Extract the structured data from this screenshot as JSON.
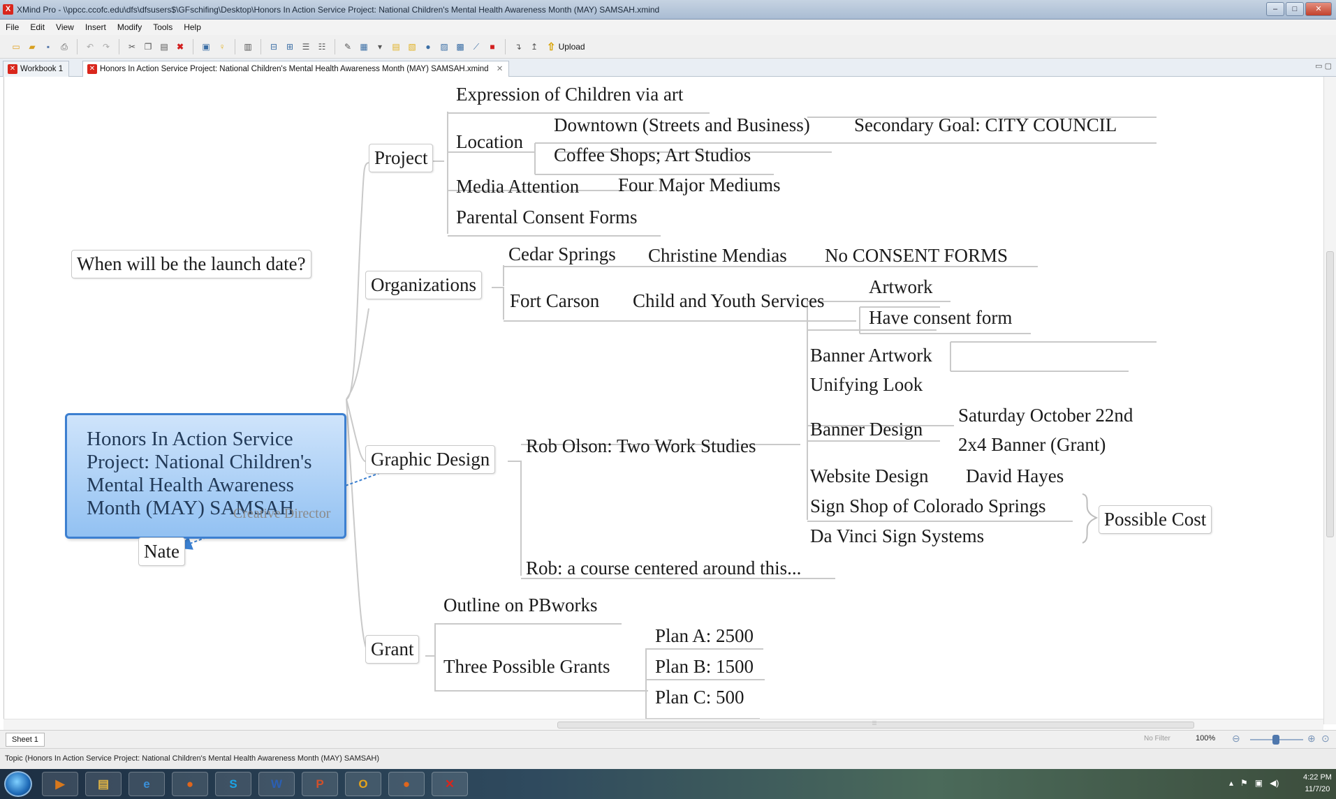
{
  "window": {
    "title": "XMind Pro - \\\\ppcc.ccofc.edu\\dfs\\dfsusers$\\GFschifing\\Desktop\\Honors In Action Service Project: National Children's Mental Health Awareness Month (MAY) SAMSAH.xmind",
    "app_icon": "X"
  },
  "menu": [
    "File",
    "Edit",
    "View",
    "Insert",
    "Modify",
    "Tools",
    "Help"
  ],
  "toolbar": {
    "icons": [
      "new-icon",
      "open-icon",
      "save-icon",
      "print-icon",
      "undo-icon",
      "redo-icon",
      "cut-icon",
      "copy-icon",
      "paste-icon",
      "delete-icon",
      "topic-icon",
      "idea-icon",
      "outline-icon",
      "insert-subtopic-icon",
      "insert-topic-icon",
      "boundary-icon",
      "summary-icon",
      "relationship-icon",
      "marker-icon",
      "notes-icon",
      "attachment-icon",
      "label-icon",
      "image-icon",
      "hyperlink-icon",
      "drilldown-icon",
      "drillup-icon"
    ],
    "upload_label": "Upload"
  },
  "tabs": [
    {
      "label": "Workbook 1"
    },
    {
      "label": "Honors In Action Service Project: National Children's Mental Health Awareness Month (MAY) SAMSAH.xmind"
    }
  ],
  "map": {
    "central": {
      "lines": [
        "Honors In Action Service",
        "Project: National Children's",
        "Mental Health Awareness",
        "Month (MAY) SAMSAH"
      ]
    },
    "floating": "When will be the launch date?",
    "nate": "Nate",
    "relationship_label": "Creative Director",
    "project": {
      "label": "Project",
      "expression": "Expression of Children via art",
      "location": "Location",
      "downtown": "Downtown (Streets and Business)",
      "secondary_goal": "Secondary Goal: CITY COUNCIL",
      "coffee": "Coffee Shops; Art Studios",
      "media": "Media Attention",
      "four_major": "Four Major Mediums",
      "parental": "Parental Consent Forms"
    },
    "organizations": {
      "label": "Organizations",
      "cedar": "Cedar Springs",
      "christine": "Christine Mendias",
      "no_consent": "No CONSENT FORMS",
      "fort_carson": "Fort Carson",
      "child_youth": "Child and Youth Services",
      "artwork": "Artwork",
      "have_consent": "Have consent form"
    },
    "graphic_design": {
      "label": "Graphic Design",
      "rob_olson": "Rob Olson: Two Work Studies",
      "banner_artwork": "Banner Artwork",
      "unifying": "Unifying Look",
      "banner_design": "Banner Design",
      "saturday": "Saturday October 22nd",
      "banner_2x4": "2x4 Banner (Grant)",
      "website": "Website Design",
      "david": "David Hayes",
      "sign_shop": "Sign Shop of Colorado Springs",
      "da_vinci": "Da Vinci Sign Systems",
      "possible_cost": "Possible Cost",
      "rob_course": "Rob: a course centered around this..."
    },
    "grant": {
      "label": "Grant",
      "outline": "Outline on PBworks",
      "three": "Three Possible Grants",
      "plan_a": "Plan A: 2500",
      "plan_b": "Plan B: 1500",
      "plan_c": "Plan C: 500"
    }
  },
  "sheet_tab": "Sheet 1",
  "filter": "No Filter",
  "zoom": "100%",
  "status": "Topic (Honors In Action Service Project: National Children's Mental Health Awareness Month (MAY) SAMSAH)",
  "taskbar": {
    "apps": [
      {
        "name": "media-player-icon",
        "glyph": "▶",
        "color": "#d8781c"
      },
      {
        "name": "explorer-icon",
        "glyph": "▤",
        "color": "#e2b545"
      },
      {
        "name": "internet-explorer-icon",
        "glyph": "e",
        "color": "#3a8fd8"
      },
      {
        "name": "firefox-icon",
        "glyph": "●",
        "color": "#e0661c"
      },
      {
        "name": "skype-icon",
        "glyph": "S",
        "color": "#1ba4e6"
      },
      {
        "name": "word-icon",
        "glyph": "W",
        "color": "#2b5fb3"
      },
      {
        "name": "powerpoint-icon",
        "glyph": "P",
        "color": "#d2502a"
      },
      {
        "name": "outlook-icon",
        "glyph": "O",
        "color": "#e5a31b"
      },
      {
        "name": "firefox-icon-2",
        "glyph": "●",
        "color": "#e0661c"
      },
      {
        "name": "xmind-icon",
        "glyph": "✕",
        "color": "#d9261c"
      }
    ],
    "time": "4:22 PM",
    "date": "11/7/20"
  }
}
